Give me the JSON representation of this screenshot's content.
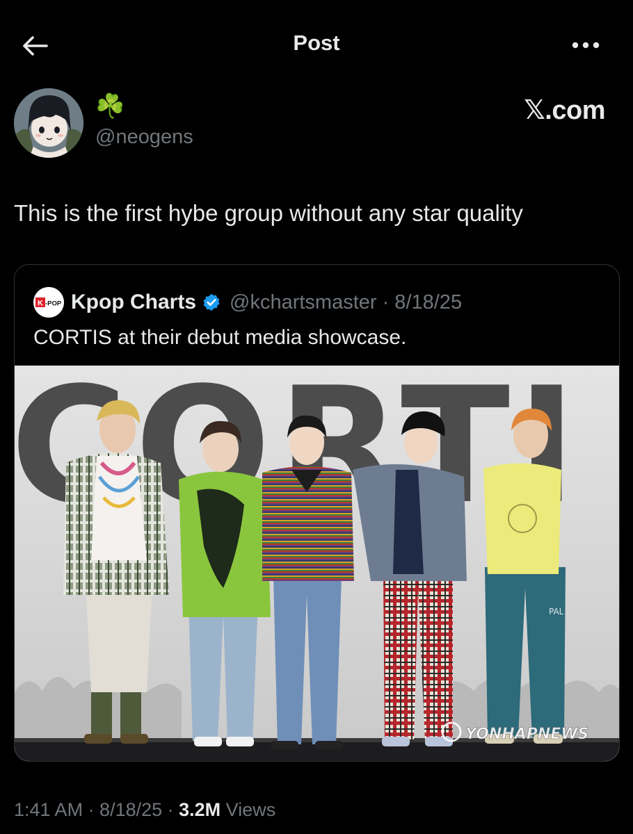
{
  "header": {
    "title": "Post"
  },
  "author": {
    "display_name": "☘️",
    "handle": "@neogens"
  },
  "source_label": "𝕏.com",
  "post": {
    "text": "This is the first hybe group without any star quality"
  },
  "quote": {
    "avatar_text": "K-POP",
    "name": "Kpop Charts",
    "handle_line": "@kchartsmaster · 8/18/25",
    "text": "CORTIS at their debut media showcase.",
    "media": {
      "backdrop_text": "CORTI",
      "watermark": "YONHAPNEWS",
      "tag": "PAL"
    }
  },
  "meta": {
    "time_date": "1:41 AM · 8/18/25 · ",
    "views_count": "3.2M",
    "views_label": " Views"
  },
  "colors": {
    "background": "#000000",
    "text": "#e7e9ea",
    "secondary": "#71767b",
    "border": "#2f3336",
    "verified": "#1d9bf0"
  },
  "icons": {
    "back": "arrow-left-icon",
    "more": "ellipsis-icon",
    "verified": "verified-badge-icon"
  }
}
